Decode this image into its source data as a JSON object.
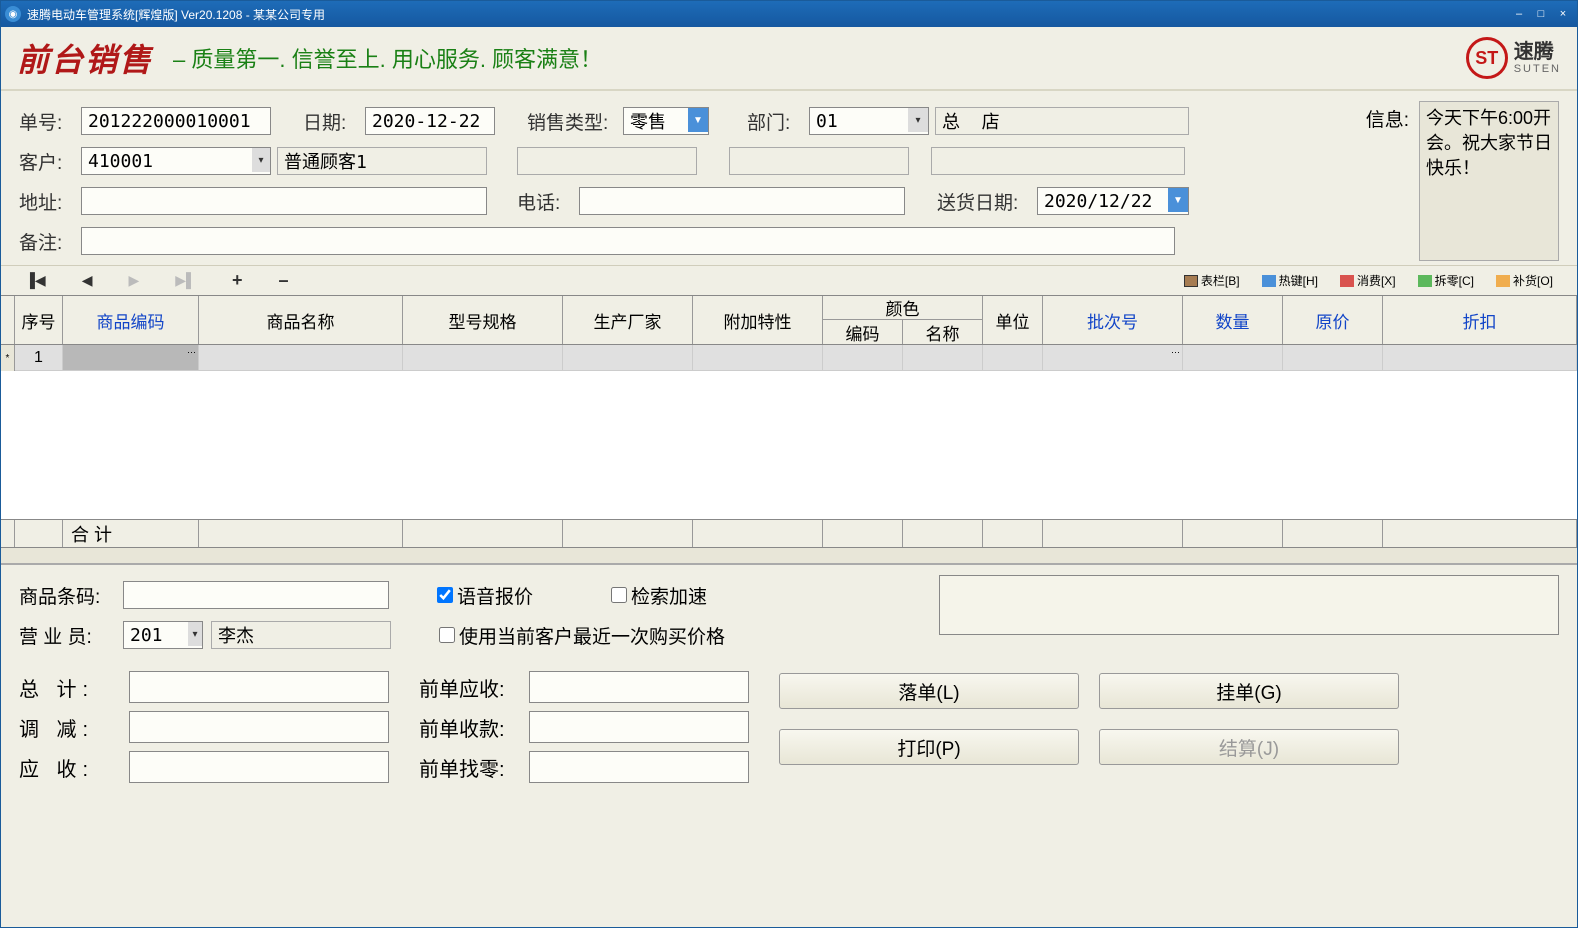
{
  "titlebar": {
    "title": "速腾电动车管理系统[辉煌版] Ver20.1208  -  某某公司专用"
  },
  "header": {
    "brand": "前台销售",
    "slogan": "– 质量第一. 信誉至上. 用心服务. 顾客满意！",
    "logo_cn": "速腾",
    "logo_en": "SUTEN",
    "logo_mark": "ST"
  },
  "form": {
    "order_no_label": "单号:",
    "order_no": "201222000010001",
    "date_label": "日期:",
    "date": "2020-12-22",
    "sale_type_label": "销售类型:",
    "sale_type": "零售",
    "dept_label": "部门:",
    "dept_code": "01",
    "dept_name": "总  店",
    "info_label": "信息:",
    "info_text": "今天下午6:00开会。祝大家节日快乐！",
    "customer_label": "客户:",
    "customer_code": "410001",
    "customer_name": "普通顾客1",
    "address_label": "地址:",
    "address": "",
    "phone_label": "电话:",
    "phone": "",
    "delivery_date_label": "送货日期:",
    "delivery_date": "2020/12/22",
    "remark_label": "备注:",
    "remark": ""
  },
  "toolbar": {
    "header_btn": "表栏[B]",
    "hotkey_btn": "热键[H]",
    "consume_btn": "消费[X]",
    "split_btn": "拆零[C]",
    "restock_btn": "补货[O]"
  },
  "grid": {
    "headers": {
      "seq": "序号",
      "code": "商品编码",
      "name": "商品名称",
      "spec": "型号规格",
      "mfr": "生产厂家",
      "attr": "附加特性",
      "color": "颜色",
      "color_code": "编码",
      "color_name": "名称",
      "unit": "单位",
      "batch": "批次号",
      "qty": "数量",
      "price": "原价",
      "disc": "折扣"
    },
    "rows": [
      {
        "seq": "1"
      }
    ],
    "footer_label": "合  计"
  },
  "bottom": {
    "barcode_label": "商品条码:",
    "barcode": "",
    "voice_quote": "语音报价",
    "search_accel": "检索加速",
    "salesperson_label": "营 业 员:",
    "salesperson_code": "201",
    "salesperson_name": "李杰",
    "use_last_price": "使用当前客户最近一次购买价格"
  },
  "totals": {
    "total_label": "总  计:",
    "discount_label": "调  减:",
    "receivable_label": "应  收:",
    "prev_receivable_label": "前单应收:",
    "prev_received_label": "前单收款:",
    "prev_change_label": "前单找零:"
  },
  "actions": {
    "drop": "落单(L)",
    "hold": "挂单(G)",
    "print": "打印(P)",
    "settle": "结算(J)"
  }
}
